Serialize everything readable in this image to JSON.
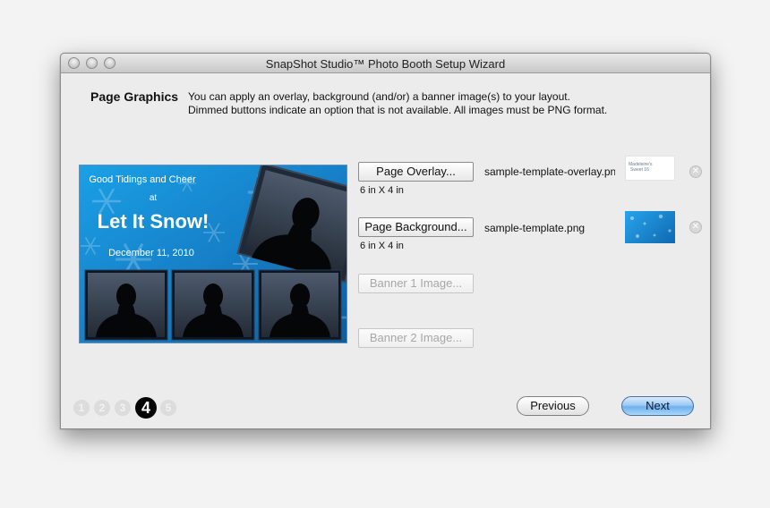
{
  "window": {
    "title": "SnapShot Studio™ Photo Booth Setup Wizard"
  },
  "page": {
    "heading": "Page Graphics",
    "description_line1": "You can apply an overlay, background (and/or) a banner image(s) to your layout.",
    "description_line2": "Dimmed buttons indicate an option that is not available. All images must be PNG format."
  },
  "preview": {
    "line1": "Good Tidings and Cheer",
    "line2": "at",
    "line3": "Let It Snow!",
    "line4": "December 11, 2010"
  },
  "graphics": [
    {
      "button_label": "Page Overlay...",
      "enabled": true,
      "size": "6 in X 4 in",
      "filename": "sample-template-overlay.png",
      "thumb_text_1": "Madeleine's",
      "thumb_text_2": "Sweet 16"
    },
    {
      "button_label": "Page Background...",
      "enabled": true,
      "size": "6 in X 4 in",
      "filename": "sample-template.png"
    },
    {
      "button_label": "Banner 1 Image...",
      "enabled": false
    },
    {
      "button_label": "Banner 2 Image...",
      "enabled": false
    }
  ],
  "steps": {
    "labels": [
      "1",
      "2",
      "3",
      "4",
      "5"
    ],
    "current": 4
  },
  "navigation": {
    "previous_label": "Previous",
    "next_label": "Next"
  },
  "colors": {
    "next_button_blue": "#6fb0ec",
    "preview_blue": "#1c8fd6",
    "active_step": "#050505"
  }
}
